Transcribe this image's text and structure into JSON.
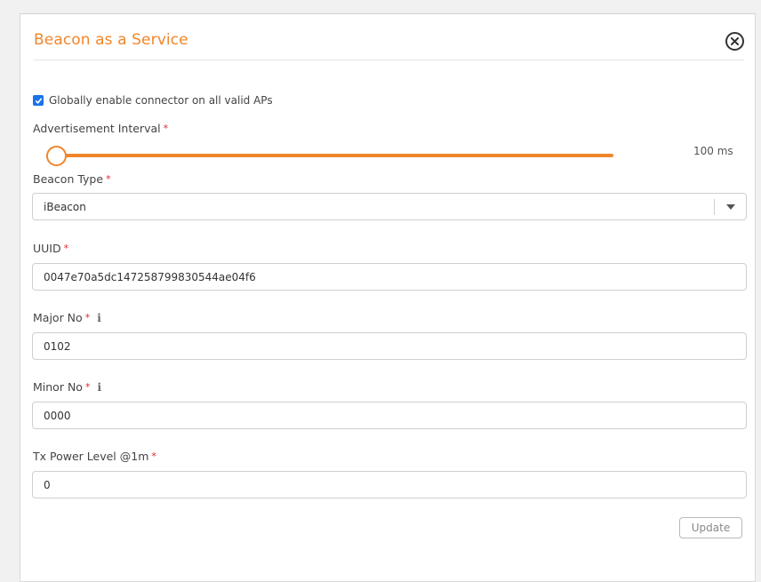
{
  "dialog": {
    "title": "Beacon as a Service"
  },
  "form": {
    "global_enable": {
      "label": "Globally enable connector on all valid APs",
      "checked": true
    },
    "advertisement_interval": {
      "label": "Advertisement Interval",
      "required_mark": "*",
      "value": "100 ms",
      "slider_fraction": 0.0
    },
    "beacon_type": {
      "label": "Beacon Type",
      "required_mark": "*",
      "value": "iBeacon"
    },
    "uuid": {
      "label": "UUID",
      "required_mark": "*",
      "value": "0047e70a5dc147258799830544ae04f6"
    },
    "major_no": {
      "label": "Major No",
      "required_mark": "*",
      "info_icon": "i",
      "value": "0102"
    },
    "minor_no": {
      "label": "Minor No",
      "required_mark": "*",
      "info_icon": "i",
      "value": "0000"
    },
    "tx_power": {
      "label": "Tx Power Level @1m",
      "required_mark": "*",
      "value": "0"
    }
  },
  "actions": {
    "update_label": "Update"
  },
  "colors": {
    "accent": "#f0862a",
    "required": "#e3262d",
    "checkbox": "#1a73e8"
  }
}
